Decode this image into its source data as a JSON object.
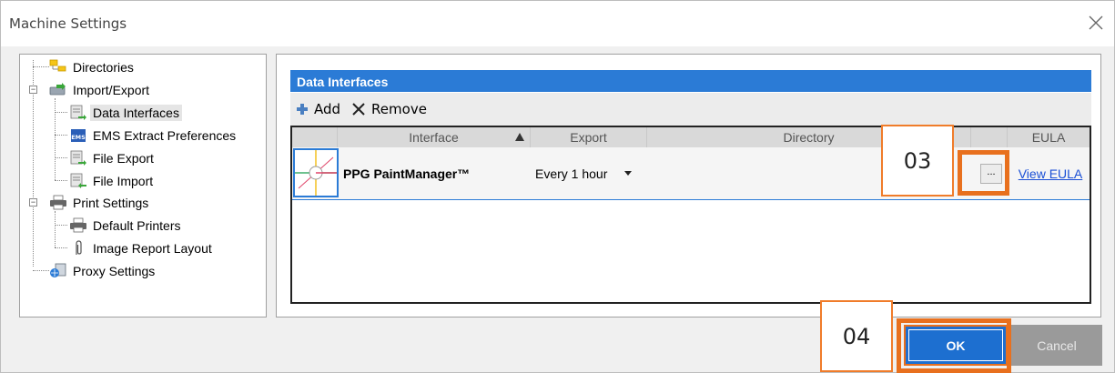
{
  "window": {
    "title": "Machine Settings"
  },
  "tree": {
    "items": [
      {
        "label": "Directories",
        "icon": "folder-tree-icon"
      },
      {
        "label": "Import/Export",
        "icon": "import-export-icon"
      },
      {
        "label": "Data Interfaces",
        "icon": "data-interface-icon",
        "selected": true
      },
      {
        "label": "EMS Extract Preferences",
        "icon": "ems-icon"
      },
      {
        "label": "File Export",
        "icon": "file-export-icon"
      },
      {
        "label": "File Import",
        "icon": "file-import-icon"
      },
      {
        "label": "Print Settings",
        "icon": "printer-icon"
      },
      {
        "label": "Default Printers",
        "icon": "printer-icon"
      },
      {
        "label": "Image Report Layout",
        "icon": "paperclip-icon"
      },
      {
        "label": "Proxy Settings",
        "icon": "proxy-icon"
      }
    ],
    "ems_badge": "EMS"
  },
  "data_interfaces": {
    "header": "Data Interfaces",
    "toolbar": {
      "add_label": "Add",
      "remove_label": "Remove"
    },
    "columns": {
      "interface": "Interface",
      "export": "Export",
      "directory": "Directory",
      "eula": "EULA"
    },
    "rows": [
      {
        "interface": "PPG PaintManager™",
        "export": "Every 1 hour",
        "directory": "",
        "browse_label": "...",
        "eula_link": "View EULA"
      }
    ]
  },
  "annotations": {
    "callout_03": "03",
    "callout_04": "04"
  },
  "footer": {
    "ok_label": "OK",
    "cancel_label": "Cancel"
  },
  "colors": {
    "accent": "#2b7bd6",
    "highlight": "#e8701e",
    "link": "#1a4fd6"
  }
}
